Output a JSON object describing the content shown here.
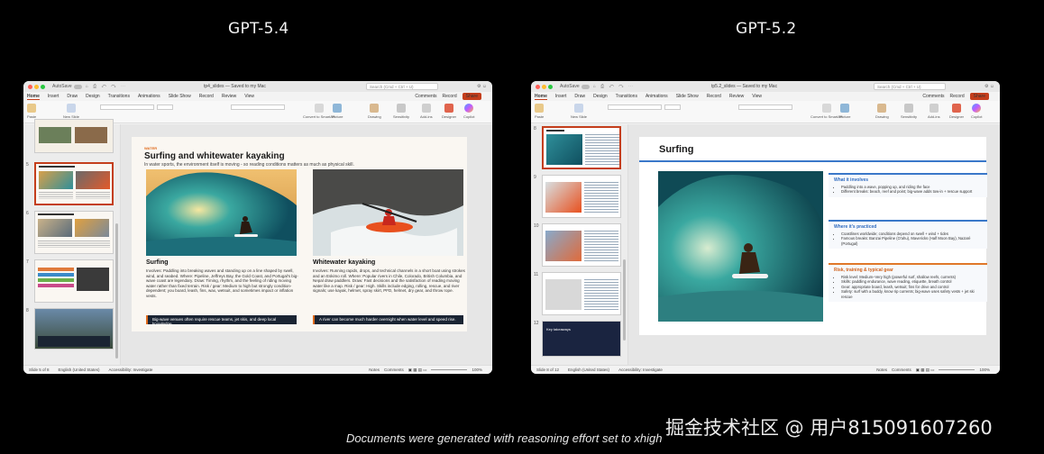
{
  "headings": {
    "left": "GPT-5.4",
    "right": "GPT-5.2"
  },
  "caption": "Documents were generated with reasoning effort set to xhigh",
  "watermark": "掘金技术社区 @ 用户815091607260",
  "left_window": {
    "titlebar": {
      "autosave": "AutoSave",
      "title": "tp4_slides — Saved to my Mac",
      "search": "Search (Cmd + Ctrl + U)"
    },
    "menu": [
      "Home",
      "Insert",
      "Draw",
      "Design",
      "Transitions",
      "Animations",
      "Slide Show",
      "Record",
      "Review",
      "View"
    ],
    "actions": {
      "comments": "Comments",
      "record": "Record",
      "share": "Share"
    },
    "ribbon": {
      "paste": "Paste",
      "new_slide": "New Slide",
      "picture": "Picture",
      "drawing": "Drawing",
      "sensitivity": "Sensitivity",
      "addins": "Add-ins",
      "designer": "Designer",
      "copilot": "Copilot",
      "convert": "Convert to SmartArt"
    },
    "thumb_numbers": [
      "5",
      "6",
      "7",
      "8"
    ],
    "slide": {
      "kicker": "WATER",
      "title": "Surfing and whitewater kayaking",
      "subtitle": "In water sports, the environment itself is moving - so reading conditions matters as much as physical skill.",
      "col1": {
        "heading": "Surfing",
        "body": "Involves: Paddling into breaking waves and standing up on a line shaped by swell, wind, and seabed. Where: Pipeline, Jeffreys Bay, the Gold Coast, and Portugal's big-wave coast are legendary. Draw: Timing, rhythm, and the feeling of riding moving water rather than fixed terrain. Risk / gear: Medium to high but strongly condition-dependent; you board, leash, fins, wax, wetsuit, and sometimes impact or inflation vests.",
        "bar": "Big-wave venues often require rescue teams, jet skis, and deep local knowledge."
      },
      "col2": {
        "heading": "Whitewater kayaking",
        "body": "Involves: Running rapids, drops, and technical channels in a short boat using strokes and an Eskimo roll. Where: Popular rivers in Chile, Colorado, British Columbia, and Nepal draw paddlers. Draw: Fast decisions and the satisfaction of reading moving water like a map. Risk / gear: High. Skills include edging, rolling, rescue, and river signals; use kayak, helmet, spray skirt, PFD, helmet, dry gear, and throw rope.",
        "bar": "A river can become much harder overnight when water level and speed rise."
      }
    },
    "status": {
      "slide": "Slide 5 of 8",
      "lang": "English (United States)",
      "accessibility": "Accessibility: Investigate",
      "notes": "Notes",
      "comments": "Comments",
      "zoom": "100%"
    }
  },
  "right_window": {
    "titlebar": {
      "autosave": "AutoSave",
      "title": "tp5.2_slides — Saved to my Mac",
      "search": "Search (Cmd + Ctrl + U)"
    },
    "menu": [
      "Home",
      "Insert",
      "Draw",
      "Design",
      "Transitions",
      "Animations",
      "Slide Show",
      "Record",
      "Review",
      "View"
    ],
    "actions": {
      "comments": "Comments",
      "record": "Record",
      "share": "Share"
    },
    "ribbon": {
      "paste": "Paste",
      "new_slide": "New Slide",
      "picture": "Picture",
      "drawing": "Drawing",
      "sensitivity": "Sensitivity",
      "addins": "Add-ins",
      "designer": "Designer",
      "copilot": "Copilot",
      "convert": "Convert to SmartArt"
    },
    "thumb_numbers": [
      "8",
      "9",
      "10",
      "11",
      "12"
    ],
    "thumb_title_last": "Key takeaways",
    "slide": {
      "title": "Surfing",
      "cards": [
        {
          "heading": "What it involves",
          "color": "#3a78c9",
          "bullets": [
            "Paddling into a wave, popping up, and riding the face",
            "Different breaks: beach, reef and point; big-wave adds tow-in + rescue support"
          ]
        },
        {
          "heading": "Where it's practiced",
          "color": "#3a78c9",
          "bullets": [
            "Coastlines worldwide; conditions depend on swell + wind + tides",
            "Famous breaks: Banzai Pipeline (O'ahu), Mavericks (Half Moon Bay), Nazaré (Portugal)"
          ]
        },
        {
          "heading": "Risk, training & typical gear",
          "color": "#e0782a",
          "bullets": [
            "Risk level: Medium–Very high (powerful surf, shallow reefs, currents)",
            "Skills: paddling endurance, wave reading, etiquette, breath control",
            "Gear: appropriate board, leash, wetsuit; fins for drive and control",
            "Safety: surf with a buddy, know rip currents; big-wave uses safety vests + jet ski rescue"
          ]
        }
      ]
    },
    "status": {
      "slide": "Slide 8 of 12",
      "lang": "English (United States)",
      "accessibility": "Accessibility: Investigate",
      "notes": "Notes",
      "comments": "Comments",
      "zoom": "100%"
    }
  }
}
